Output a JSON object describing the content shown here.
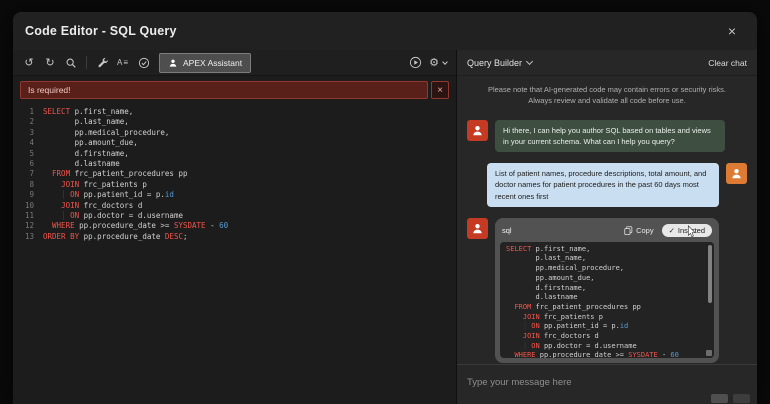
{
  "window": {
    "title": "Code Editor - SQL Query"
  },
  "icons": {
    "close": "×",
    "undo": "↺",
    "redo": "↻",
    "autocomplete": "A≡",
    "gear": "⚙",
    "check": "✓"
  },
  "toolbar": {
    "assistant_label": "APEX Assistant"
  },
  "error_bar": {
    "message": "Is required!"
  },
  "sql_lines": [
    [
      [
        "kw",
        "SELECT"
      ],
      [
        "t",
        " p.first_name,"
      ]
    ],
    [
      [
        "t",
        "       p.last_name,"
      ]
    ],
    [
      [
        "t",
        "       pp.medical_procedure,"
      ]
    ],
    [
      [
        "t",
        "       pp.amount_due,"
      ]
    ],
    [
      [
        "t",
        "       d.firstname,"
      ]
    ],
    [
      [
        "t",
        "       d.lastname"
      ]
    ],
    [
      [
        "t",
        "  "
      ],
      [
        "kw",
        "FROM"
      ],
      [
        "t",
        " frc_patient_procedures pp"
      ]
    ],
    [
      [
        "t",
        "    "
      ],
      [
        "kw",
        "JOIN"
      ],
      [
        "t",
        " frc_patients p"
      ]
    ],
    [
      [
        "t",
        "    "
      ],
      [
        "gd",
        "│"
      ],
      [
        "t",
        " "
      ],
      [
        "kw",
        "ON"
      ],
      [
        "t",
        " pp.patient_id = p."
      ],
      [
        "num",
        "id"
      ]
    ],
    [
      [
        "t",
        "    "
      ],
      [
        "kw",
        "JOIN"
      ],
      [
        "t",
        " frc_doctors d"
      ]
    ],
    [
      [
        "t",
        "    "
      ],
      [
        "gd",
        "│"
      ],
      [
        "t",
        " "
      ],
      [
        "kw",
        "ON"
      ],
      [
        "t",
        " pp.doctor = d.username"
      ]
    ],
    [
      [
        "t",
        "  "
      ],
      [
        "kw",
        "WHERE"
      ],
      [
        "t",
        " pp.procedure_date >= "
      ],
      [
        "kw",
        "SYSDATE"
      ],
      [
        "t",
        " - "
      ],
      [
        "num",
        "60"
      ]
    ],
    [
      [
        "kw",
        "ORDER BY"
      ],
      [
        "t",
        " pp.procedure_date "
      ],
      [
        "kw",
        "DESC"
      ],
      [
        "t",
        ";"
      ]
    ]
  ],
  "chat": {
    "header": {
      "query_builder": "Query Builder",
      "clear_chat": "Clear chat"
    },
    "disclaimer": "Please note that AI-generated code may contain errors or security risks. Always review and validate all code before use.",
    "assistant_message": "Hi there, I can help you author SQL based on tables and views in your current schema. What can I help you query?",
    "user_message": "List of patient names, procedure descriptions, total amount, and doctor names for patient procedures in the past 60 days most recent ones first",
    "code_card": {
      "language": "sql",
      "copy_label": "Copy",
      "inserted_label": "Inserted"
    },
    "input_placeholder": "Type your message here"
  },
  "colors": {
    "keyword": "#f2544b",
    "literal": "#569cd6",
    "assistant_bubble": "#3e4f42",
    "user_bubble": "#c9def0",
    "avatar_red": "#c53a22",
    "avatar_orange": "#dd7a33",
    "error_bg": "#59201a"
  }
}
